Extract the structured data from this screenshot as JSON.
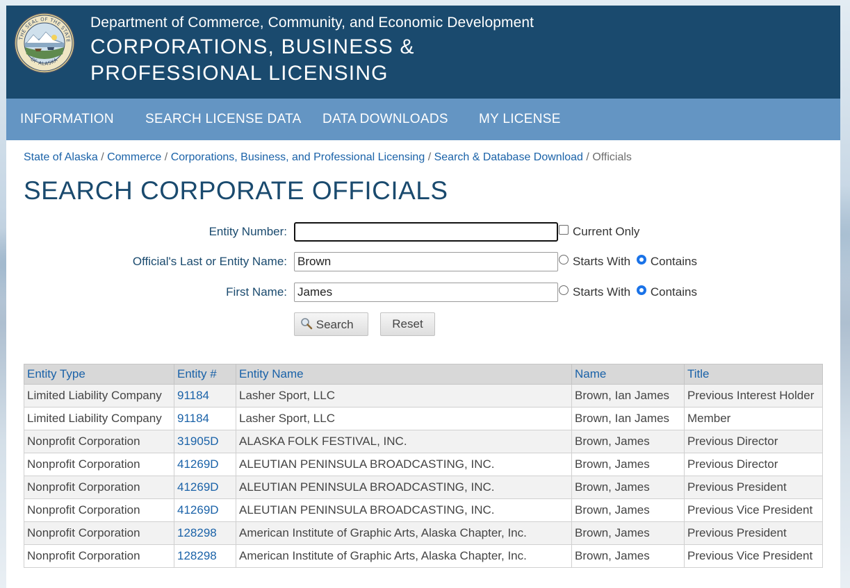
{
  "header": {
    "department": "Department of Commerce, Community, and Economic Development",
    "division": "CORPORATIONS, BUSINESS & PROFESSIONAL LICENSING",
    "seal_text": "THE SEAL OF THE STATE OF ALASKA"
  },
  "nav": {
    "items": [
      {
        "label": "INFORMATION"
      },
      {
        "label": "SEARCH LICENSE DATA"
      },
      {
        "label": "DATA DOWNLOADS"
      },
      {
        "label": "MY LICENSE"
      }
    ]
  },
  "breadcrumb": {
    "items": [
      {
        "label": "State of Alaska"
      },
      {
        "label": "Commerce"
      },
      {
        "label": "Corporations, Business, and Professional Licensing"
      },
      {
        "label": "Search & Database Download"
      }
    ],
    "current": "Officials",
    "separator": "/"
  },
  "page": {
    "title": "SEARCH CORPORATE OFFICIALS"
  },
  "form": {
    "entity_number": {
      "label": "Entity Number:",
      "value": ""
    },
    "current_only": {
      "label": "Current Only",
      "checked": false
    },
    "last_name": {
      "label": "Official's Last or Entity Name:",
      "value": "Brown",
      "starts_with": "Starts With",
      "contains": "Contains",
      "selected": "Contains"
    },
    "first_name": {
      "label": "First Name:",
      "value": "James",
      "starts_with": "Starts With",
      "contains": "Contains",
      "selected": "Contains"
    },
    "search_button": "Search",
    "reset_button": "Reset"
  },
  "results": {
    "columns": [
      "Entity Type",
      "Entity #",
      "Entity Name",
      "Name",
      "Title"
    ],
    "rows": [
      [
        "Limited Liability Company",
        "91184",
        "Lasher Sport, LLC",
        "Brown, Ian James",
        "Previous Interest Holder"
      ],
      [
        "Limited Liability Company",
        "91184",
        "Lasher Sport, LLC",
        "Brown, Ian James",
        "Member"
      ],
      [
        "Nonprofit Corporation",
        "31905D",
        "ALASKA FOLK FESTIVAL, INC.",
        "Brown, James",
        "Previous Director"
      ],
      [
        "Nonprofit Corporation",
        "41269D",
        "ALEUTIAN PENINSULA BROADCASTING, INC.",
        "Brown, James",
        "Previous Director"
      ],
      [
        "Nonprofit Corporation",
        "41269D",
        "ALEUTIAN PENINSULA BROADCASTING, INC.",
        "Brown, James",
        "Previous President"
      ],
      [
        "Nonprofit Corporation",
        "41269D",
        "ALEUTIAN PENINSULA BROADCASTING, INC.",
        "Brown, James",
        "Previous Vice President"
      ],
      [
        "Nonprofit Corporation",
        "128298",
        "American Institute of Graphic Arts, Alaska Chapter, Inc.",
        "Brown, James",
        "Previous President"
      ],
      [
        "Nonprofit Corporation",
        "128298",
        "American Institute of Graphic Arts, Alaska Chapter, Inc.",
        "Brown, James",
        "Previous Vice President"
      ]
    ]
  },
  "colors": {
    "header_bg": "#1a4a6e",
    "nav_bg": "#6495c3",
    "link": "#1a62a8",
    "title": "#1a4a6e",
    "table_header_bg": "#d8d8d8",
    "row_alt_bg": "#f2f2f2"
  },
  "icons": {
    "search_button_icon": "magnifier-icon",
    "logo": "alaska-state-seal-icon"
  }
}
